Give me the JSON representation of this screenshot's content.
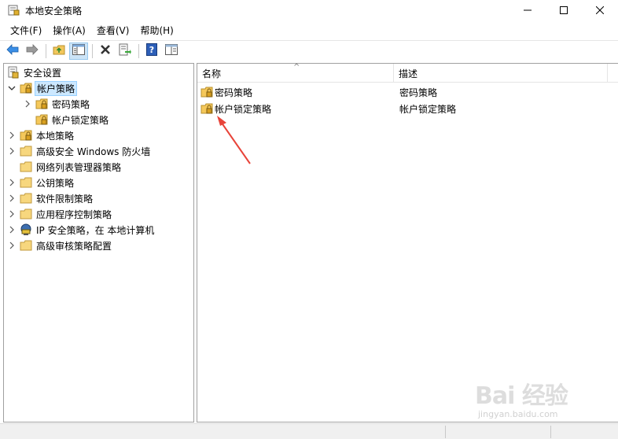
{
  "window": {
    "title": "本地安全策略"
  },
  "menu": {
    "items": [
      "文件(F)",
      "操作(A)",
      "查看(V)",
      "帮助(H)"
    ]
  },
  "toolbar": {
    "buttons": [
      "back-arrow-icon",
      "forward-arrow-icon",
      "up-folder-icon",
      "show-hide-tree-icon",
      "delete-x-icon",
      "export-list-icon",
      "help-icon",
      "properties-icon"
    ]
  },
  "tree": {
    "root": "安全设置",
    "items": [
      {
        "label": "帐户策略",
        "expanded": true,
        "selected": true
      },
      {
        "label": "密码策略"
      },
      {
        "label": "帐户锁定策略"
      },
      {
        "label": "本地策略"
      },
      {
        "label": "高级安全 Windows 防火墙"
      },
      {
        "label": "网络列表管理器策略"
      },
      {
        "label": "公钥策略"
      },
      {
        "label": "软件限制策略"
      },
      {
        "label": "应用程序控制策略"
      },
      {
        "label": "IP 安全策略，在 本地计算机"
      },
      {
        "label": "高级审核策略配置"
      }
    ]
  },
  "list": {
    "columns": [
      "名称",
      "描述"
    ],
    "rows": [
      {
        "name": "密码策略",
        "desc": "密码策略"
      },
      {
        "name": "帐户锁定策略",
        "desc": "帐户锁定策略"
      }
    ]
  },
  "watermark": {
    "logo": "Bai 经验",
    "url": "jingyan.baidu.com"
  },
  "colors": {
    "selection": "#cce8ff",
    "annotation": "#e8443a",
    "folder": "#f5c85a"
  }
}
